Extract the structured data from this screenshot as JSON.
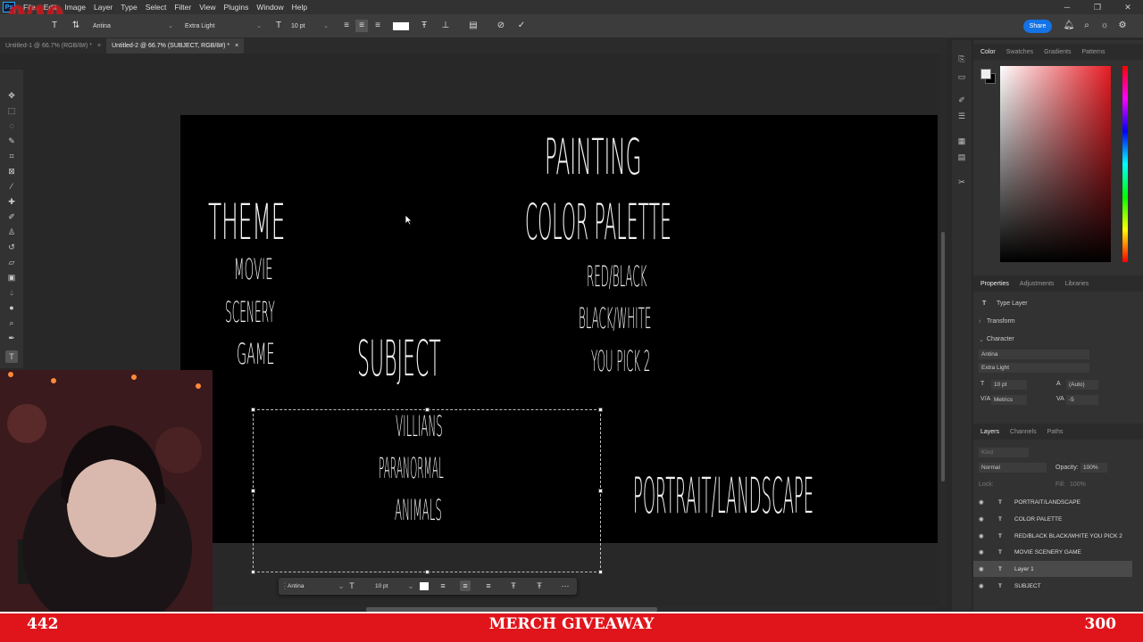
{
  "counter": "0/10",
  "menubar": {
    "app_logo": "Ps",
    "items": [
      "File",
      "Edit",
      "Image",
      "Layer",
      "Type",
      "Select",
      "Filter",
      "View",
      "Plugins",
      "Window",
      "Help"
    ]
  },
  "options_bar": {
    "font_family": "Antina",
    "font_style": "Extra Light",
    "font_size": "10 pt",
    "share_label": "Share"
  },
  "tabs": [
    {
      "label": "Untitled-1 @ 66.7% (RGB/8#) *",
      "close": "×"
    },
    {
      "label": "Untitled-2 @ 66.7% (SUBJECT, RGB/8#) *",
      "close": "×"
    }
  ],
  "canvas": {
    "painting": "PAINTING",
    "color_palette": "COLOR PALETTE",
    "theme": "THEME",
    "theme_items": [
      "MOVIE",
      "SCENERY",
      "GAME"
    ],
    "palette_items": [
      "RED/BLACK",
      "BLACK/WHITE",
      "YOU PICK 2"
    ],
    "subject": "SUBJECT",
    "subject_items": [
      "VILLIANS",
      "PARANORMAL",
      "ANIMALS"
    ],
    "portrait": "PORTRAIT/LANDSCAPE"
  },
  "color_panel": {
    "tabs": [
      "Color",
      "Swatches",
      "Gradients",
      "Patterns"
    ],
    "accent": "#e51c23"
  },
  "properties_panel": {
    "tabs": [
      "Properties",
      "Adjustments",
      "Libraries"
    ],
    "layer_type": "Type Layer",
    "transform": "Transform",
    "character": "Character",
    "font_family": "Antina",
    "font_style": "Extra Light",
    "font_size": "10 pt",
    "leading": "(Auto)",
    "kerning": "Metrics",
    "tracking": "-5"
  },
  "layers_panel": {
    "tabs": [
      "Layers",
      "Channels",
      "Paths"
    ],
    "search_placeholder": "Kind",
    "blend_mode": "Normal",
    "opacity_label": "Opacity:",
    "opacity_value": "100%",
    "lock_label": "Lock:",
    "fill_label": "Fill:",
    "fill_value": "100%",
    "layers": [
      {
        "name": "PORTRAIT/LANDSCAPE",
        "selected": false
      },
      {
        "name": "COLOR PALETTE",
        "selected": false
      },
      {
        "name": "RED/BLACK BLACK/WHITE YOU PICK 2",
        "selected": false
      },
      {
        "name": "MOVIE SCENERY GAME",
        "selected": false
      },
      {
        "name": "Layer 1",
        "selected": true
      },
      {
        "name": "SUBJECT",
        "selected": false
      }
    ]
  },
  "context_bar": {
    "font_family": "Antina",
    "font_size": "10 pt"
  },
  "banner": {
    "left": "442",
    "center": "MERCH GIVEAWAY",
    "right": "300"
  }
}
